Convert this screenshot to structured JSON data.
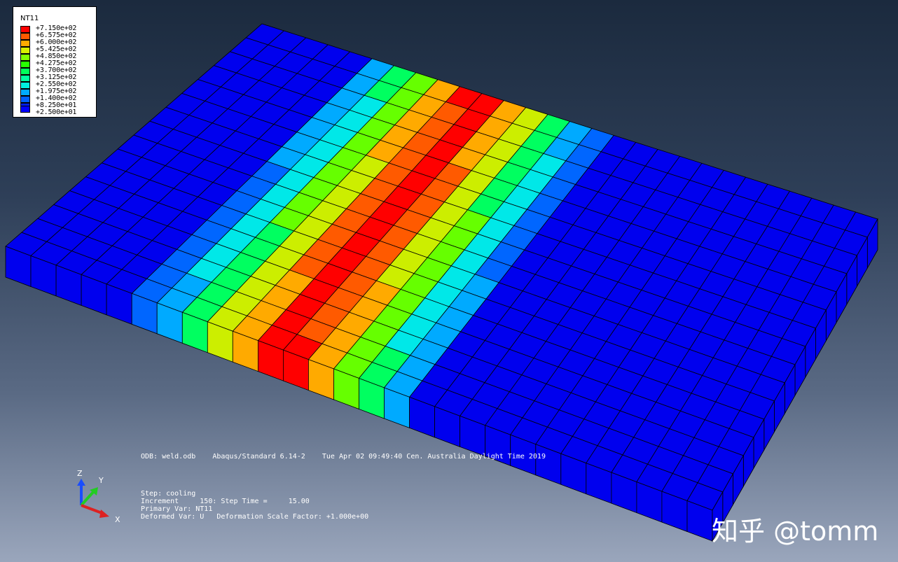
{
  "legend": {
    "title": "NT11",
    "values": [
      "+7.150e+02",
      "+6.575e+02",
      "+6.000e+02",
      "+5.425e+02",
      "+4.850e+02",
      "+4.275e+02",
      "+3.700e+02",
      "+3.125e+02",
      "+2.550e+02",
      "+1.975e+02",
      "+1.400e+02",
      "+8.250e+01",
      "+2.500e+01"
    ],
    "colors": [
      "#ff0000",
      "#ff5a00",
      "#ffaa00",
      "#d8f000",
      "#80ff00",
      "#28ff00",
      "#00ff5a",
      "#00ffa0",
      "#00f0e0",
      "#00aaff",
      "#0060ff",
      "#0020ff",
      "#0000ff"
    ]
  },
  "info": {
    "odb_line": "ODB: weld.odb    Abaqus/Standard 6.14-2    Tue Apr 02 09:49:40 Cen. Australia Daylight Time 2019",
    "step": "Step: cooling",
    "increment": "Increment     150: Step Time =     15.00",
    "primary_var": "Primary Var: NT11",
    "deformed_var": "Deformed Var: U   Deformation Scale Factor: +1.000e+00"
  },
  "triad": {
    "z_label": "Z",
    "y_label": "Y",
    "x_label": "X"
  },
  "watermark": "知乎 @tomm",
  "model": {
    "plate_color": "#0000ee",
    "weld_colors": [
      "#ff0000",
      "#ff5a00",
      "#ffaa00",
      "#ccee00",
      "#66ff00",
      "#00ff60",
      "#00e8e8",
      "#00aaff",
      "#0066ff"
    ]
  }
}
